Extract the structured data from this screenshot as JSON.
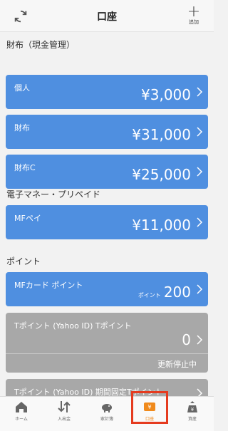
{
  "header": {
    "title": "口座",
    "add_label": "追加"
  },
  "sections": {
    "wallet": "財布（現金管理）",
    "emoney": "電子マネー・プリペイド",
    "points": "ポイント"
  },
  "accounts": [
    {
      "name": "個人",
      "amount": "¥3,000"
    },
    {
      "name": "財布",
      "amount": "¥31,000"
    },
    {
      "name": "財布C",
      "amount": "¥25,000"
    },
    {
      "name": "MFペイ",
      "amount": "¥11,000"
    },
    {
      "name": "MFカード ポイント",
      "points_label": "ポイント",
      "amount": "200"
    },
    {
      "name": "Tポイント (Yahoo ID) Tポイント",
      "amount": "0",
      "status": "更新停止中"
    },
    {
      "name": "Tポイント (Yahoo ID) 期間固定Tポイント"
    }
  ],
  "tabs": [
    {
      "label": "ホーム",
      "icon": "home-icon"
    },
    {
      "label": "入出金",
      "icon": "transfer-icon"
    },
    {
      "label": "家計簿",
      "icon": "piggy-bank-icon"
    },
    {
      "label": "口座",
      "icon": "wallet-icon",
      "active": true
    },
    {
      "label": "資産",
      "icon": "assets-icon"
    }
  ],
  "colors": {
    "card_blue": "#4f8fe0",
    "card_gray": "#a8a8a8",
    "active_tab": "#f08a1c",
    "highlight": "#e53b1f"
  }
}
